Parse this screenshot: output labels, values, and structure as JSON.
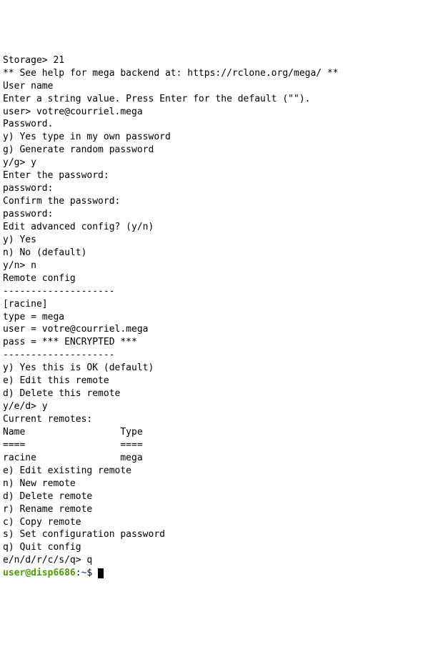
{
  "terminal": {
    "lines": [
      "Storage> 21",
      "** See help for mega backend at: https://rclone.org/mega/ **",
      "",
      "User name",
      "Enter a string value. Press Enter for the default (\"\").",
      "user> votre@courriel.mega",
      "Password.",
      "y) Yes type in my own password",
      "g) Generate random password",
      "y/g> y",
      "Enter the password:",
      "password:",
      "Confirm the password:",
      "password:",
      "Edit advanced config? (y/n)",
      "y) Yes",
      "n) No (default)",
      "y/n> n",
      "Remote config",
      "--------------------",
      "[racine]",
      "type = mega",
      "user = votre@courriel.mega",
      "pass = *** ENCRYPTED ***",
      "--------------------",
      "y) Yes this is OK (default)",
      "e) Edit this remote",
      "d) Delete this remote",
      "y/e/d> y",
      "Current remotes:",
      "",
      "Name                 Type",
      "====                 ====",
      "racine               mega",
      "",
      "e) Edit existing remote",
      "n) New remote",
      "d) Delete remote",
      "r) Rename remote",
      "c) Copy remote",
      "s) Set configuration password",
      "q) Quit config",
      "e/n/d/r/c/s/q> q"
    ],
    "prompt": {
      "user": "user",
      "at": "@",
      "host": "disp6686",
      "colon": ":",
      "path": "~",
      "dollar": "$ "
    }
  }
}
